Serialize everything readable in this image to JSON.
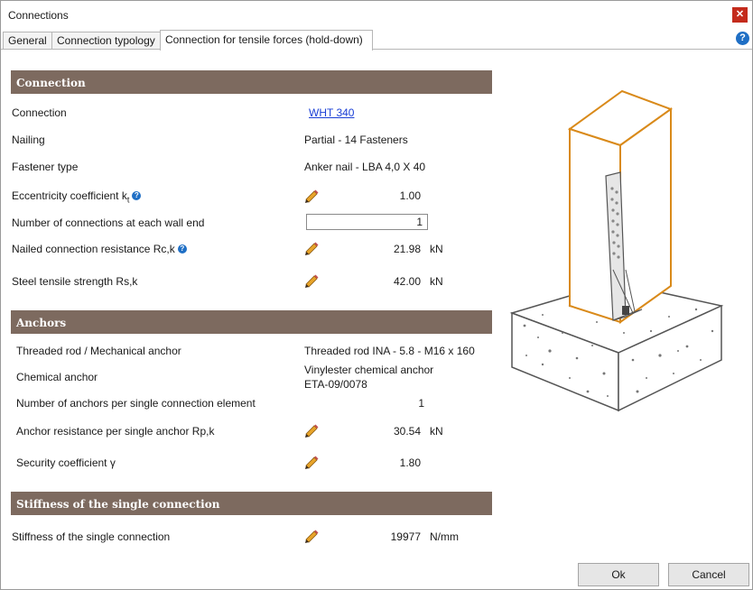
{
  "window": {
    "title": "Connections"
  },
  "tabs": [
    {
      "label": "General"
    },
    {
      "label": "Connection typology"
    },
    {
      "label": "Connection for tensile forces (hold-down)"
    }
  ],
  "sections": {
    "connection": {
      "title": "Connection",
      "rows": {
        "connection": {
          "label": "Connection",
          "value": "WHT 340"
        },
        "nailing": {
          "label": "Nailing",
          "value": "Partial - 14 Fasteners"
        },
        "fastener_type": {
          "label": "Fastener type",
          "value": "Anker nail - LBA 4,0 X 40"
        },
        "eccentricity": {
          "label": "Eccentricity coefficient  k",
          "subscript": "t",
          "value": "1.00"
        },
        "connections_each_end": {
          "label": "Number of connections at each wall end",
          "value": "1"
        },
        "nailed_resistance": {
          "label": "Nailed connection resistance  Rc,k",
          "value": "21.98",
          "unit": "kN"
        },
        "steel_tensile": {
          "label": "Steel tensile strength Rs,k",
          "value": "42.00",
          "unit": "kN"
        }
      }
    },
    "anchors": {
      "title": "Anchors",
      "rows": {
        "threaded_rod": {
          "label": "Threaded rod / Mechanical anchor",
          "value": "Threaded rod INA - 5.8 - M16 x 160"
        },
        "chemical_anchor": {
          "label": "Chemical anchor",
          "value_line1": "Vinylester chemical anchor",
          "value_line2": "ETA-09/0078"
        },
        "anchors_per_element": {
          "label": "Number of anchors per single connection element",
          "value": "1"
        },
        "anchor_resistance": {
          "label": "Anchor resistance per single anchor Rp,k",
          "value": "30.54",
          "unit": "kN"
        },
        "security_coefficient": {
          "label": "Security coefficient γ",
          "value": "1.80"
        }
      }
    },
    "stiffness": {
      "title": "Stiffness of the single connection",
      "rows": {
        "stiffness": {
          "label": "Stiffness of the single connection",
          "value": "19977",
          "unit": "N/mm"
        }
      }
    }
  },
  "buttons": {
    "ok": "Ok",
    "cancel": "Cancel"
  },
  "icons": {
    "close": "close-icon",
    "help": "help-icon",
    "edit": "pencil-icon",
    "info": "question-icon"
  },
  "colors": {
    "section_header": "#7d6a5f",
    "link": "#1a3fd6",
    "timber_outline": "#d98a1a",
    "close": "#c42b1c"
  }
}
